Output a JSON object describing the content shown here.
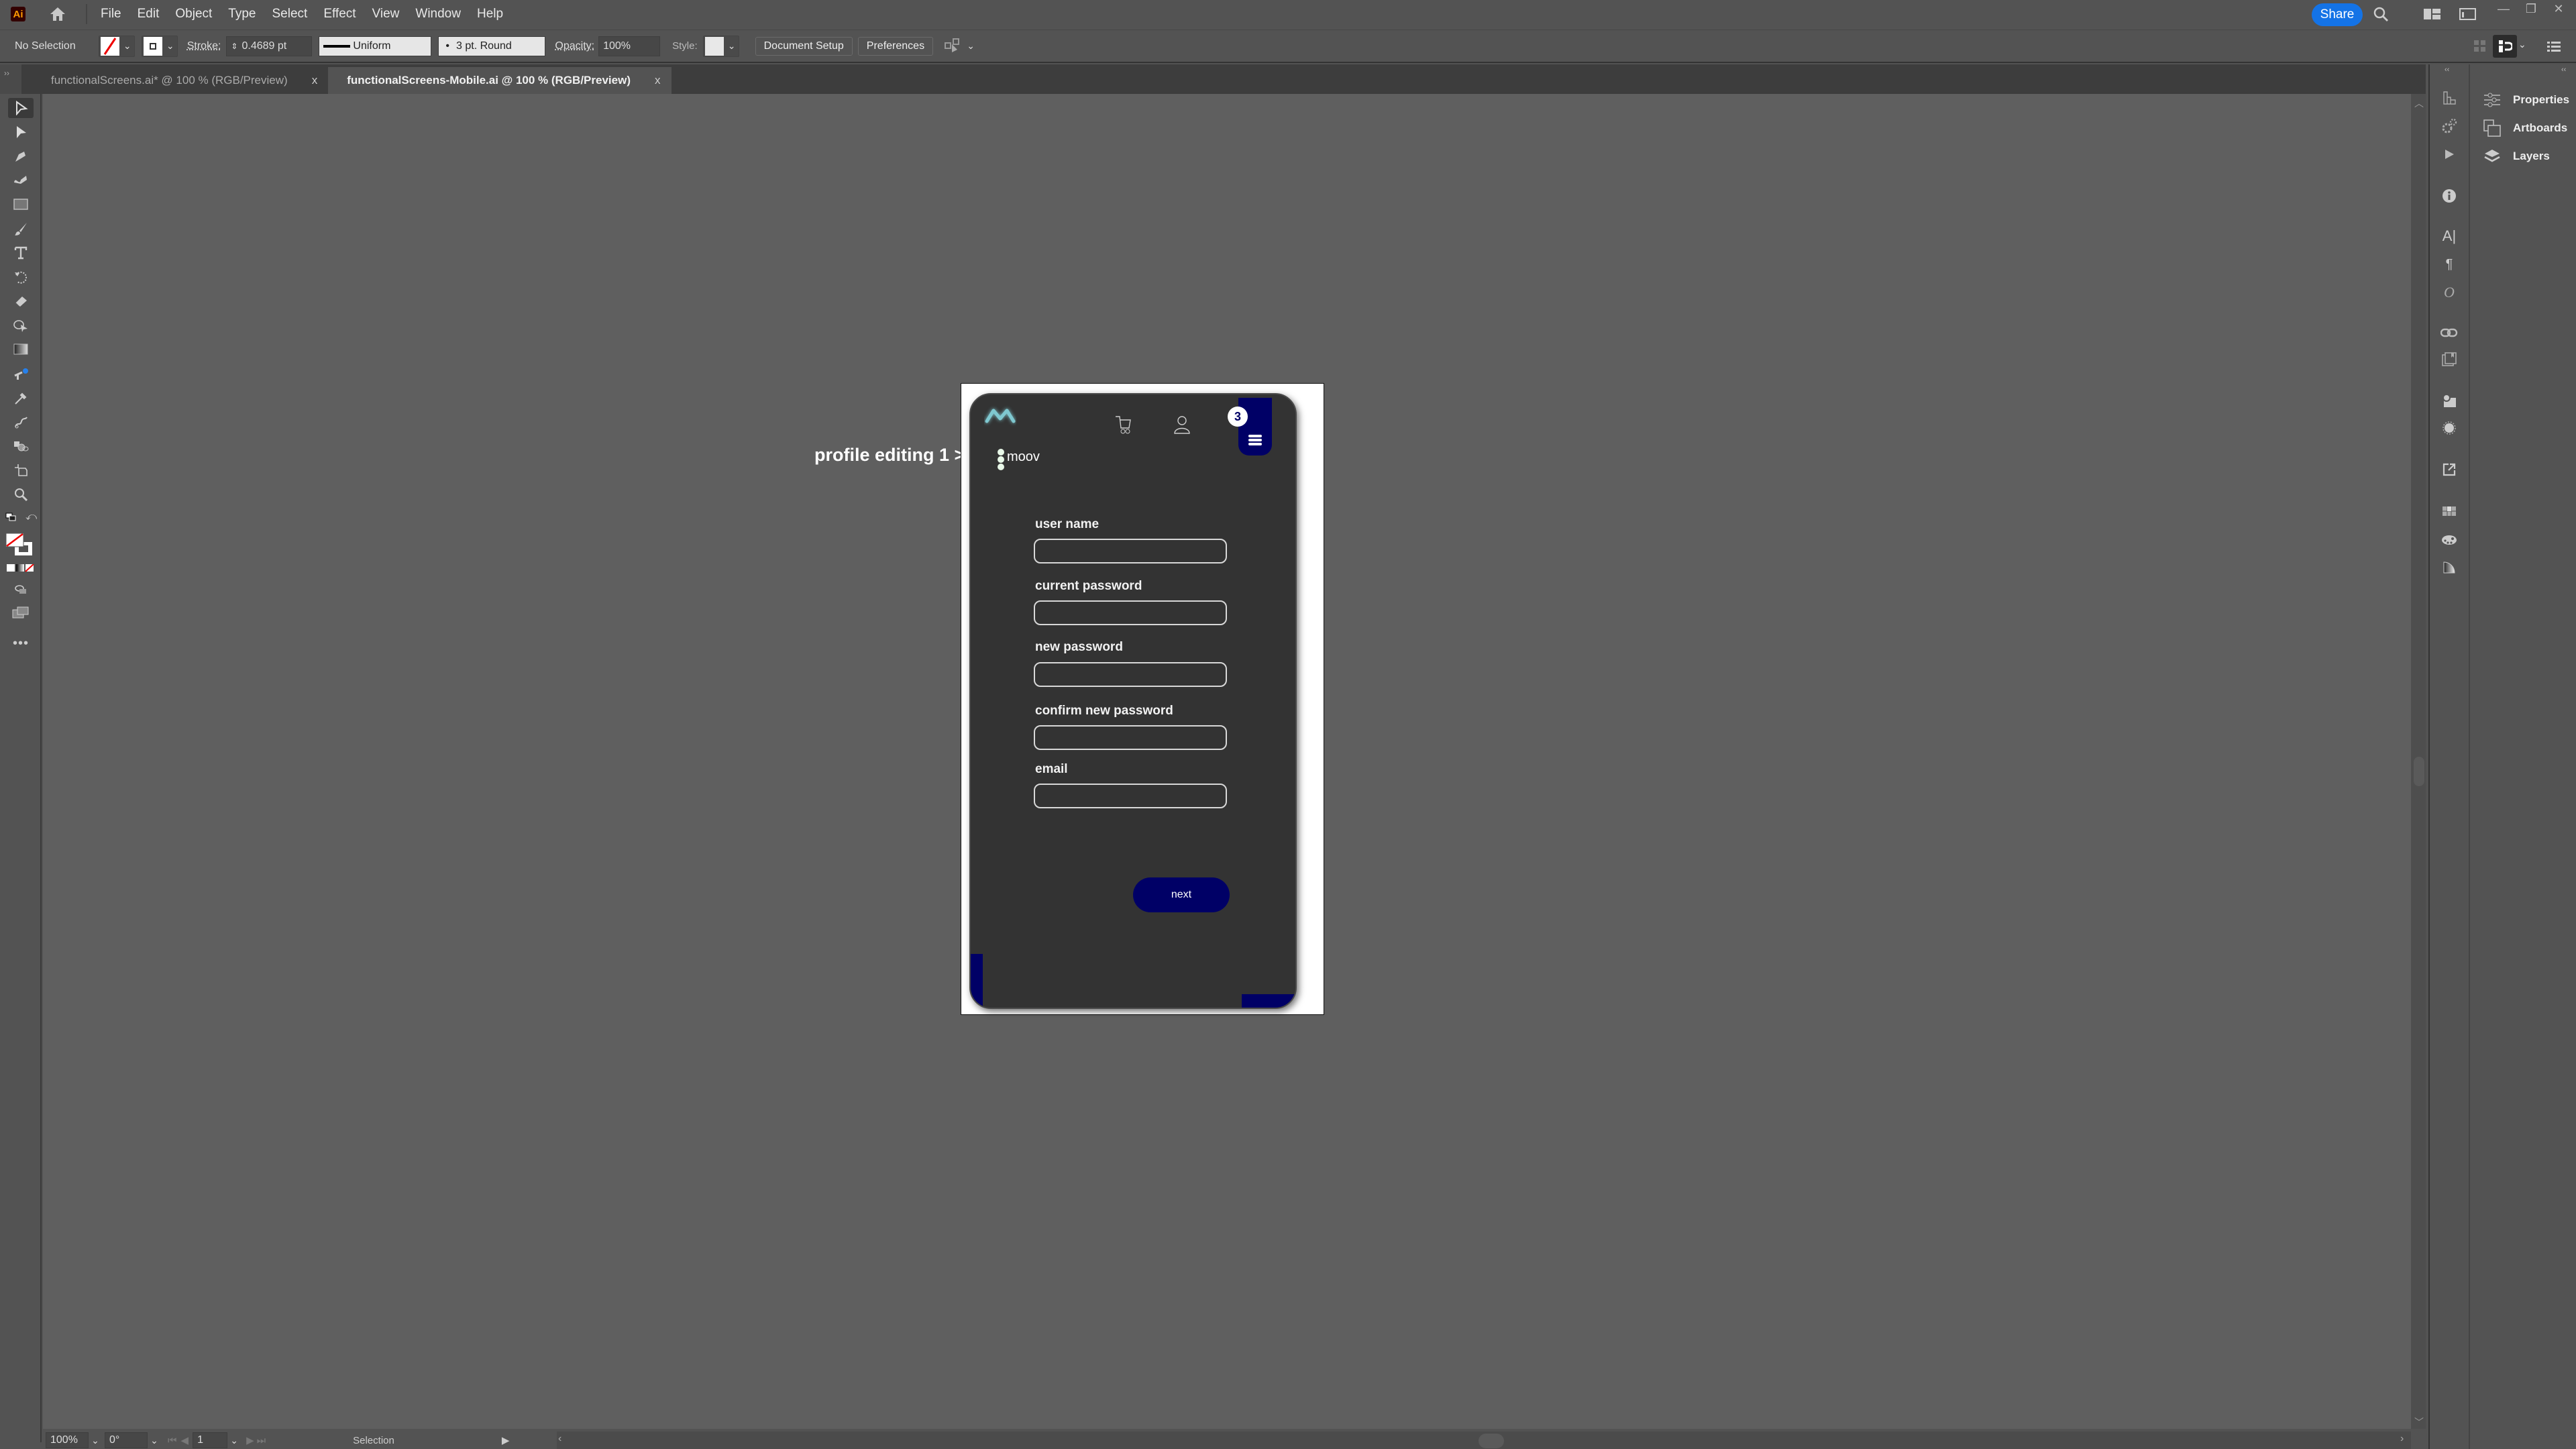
{
  "app": {
    "logo": "Ai",
    "menu": [
      "File",
      "Edit",
      "Object",
      "Type",
      "Select",
      "Effect",
      "View",
      "Window",
      "Help"
    ],
    "share_label": "Share"
  },
  "control_bar": {
    "selection_status": "No Selection",
    "stroke_label": "Stroke:",
    "stroke_weight": "0.4689 pt",
    "stroke_profile": "Uniform",
    "brush": "3 pt. Round",
    "opacity_label": "Opacity:",
    "opacity_value": "100%",
    "style_label": "Style:",
    "document_setup": "Document Setup",
    "preferences": "Preferences"
  },
  "tabs": [
    {
      "label": "functionalScreens.ai* @ 100 % (RGB/Preview)",
      "active": false
    },
    {
      "label": "functionalScreens-Mobile.ai @ 100 % (RGB/Preview)",
      "active": true
    }
  ],
  "tab_close": "x",
  "tools": [
    "selection",
    "direct-selection",
    "pen",
    "curvature",
    "rectangle",
    "paintbrush",
    "type",
    "rotate",
    "eraser",
    "shape-builder",
    "gradient",
    "puppet-warp",
    "eyedropper",
    "blend",
    "symbol-sprayer",
    "artboard",
    "zoom"
  ],
  "right_panels": [
    {
      "label": "Properties",
      "icon": "sliders-icon"
    },
    {
      "label": "Artboards",
      "icon": "artboards-icon"
    },
    {
      "label": "Layers",
      "icon": "layers-icon"
    }
  ],
  "status_bar": {
    "zoom": "100%",
    "rotation": "0°",
    "artboard_number": "1",
    "tool": "Selection"
  },
  "artboard": {
    "name_label": "profile editing 1 >",
    "brand_name": "moov",
    "cart_badge_count": "3",
    "colors": {
      "primary": "#000066",
      "phone_bg": "#333333",
      "logo": "#7fc8d0"
    },
    "form_fields": [
      {
        "label": "user name",
        "value": ""
      },
      {
        "label": "current password",
        "value": ""
      },
      {
        "label": "new password",
        "value": ""
      },
      {
        "label": "confirm new password",
        "value": ""
      },
      {
        "label": "email",
        "value": ""
      }
    ],
    "next_button": "next"
  }
}
